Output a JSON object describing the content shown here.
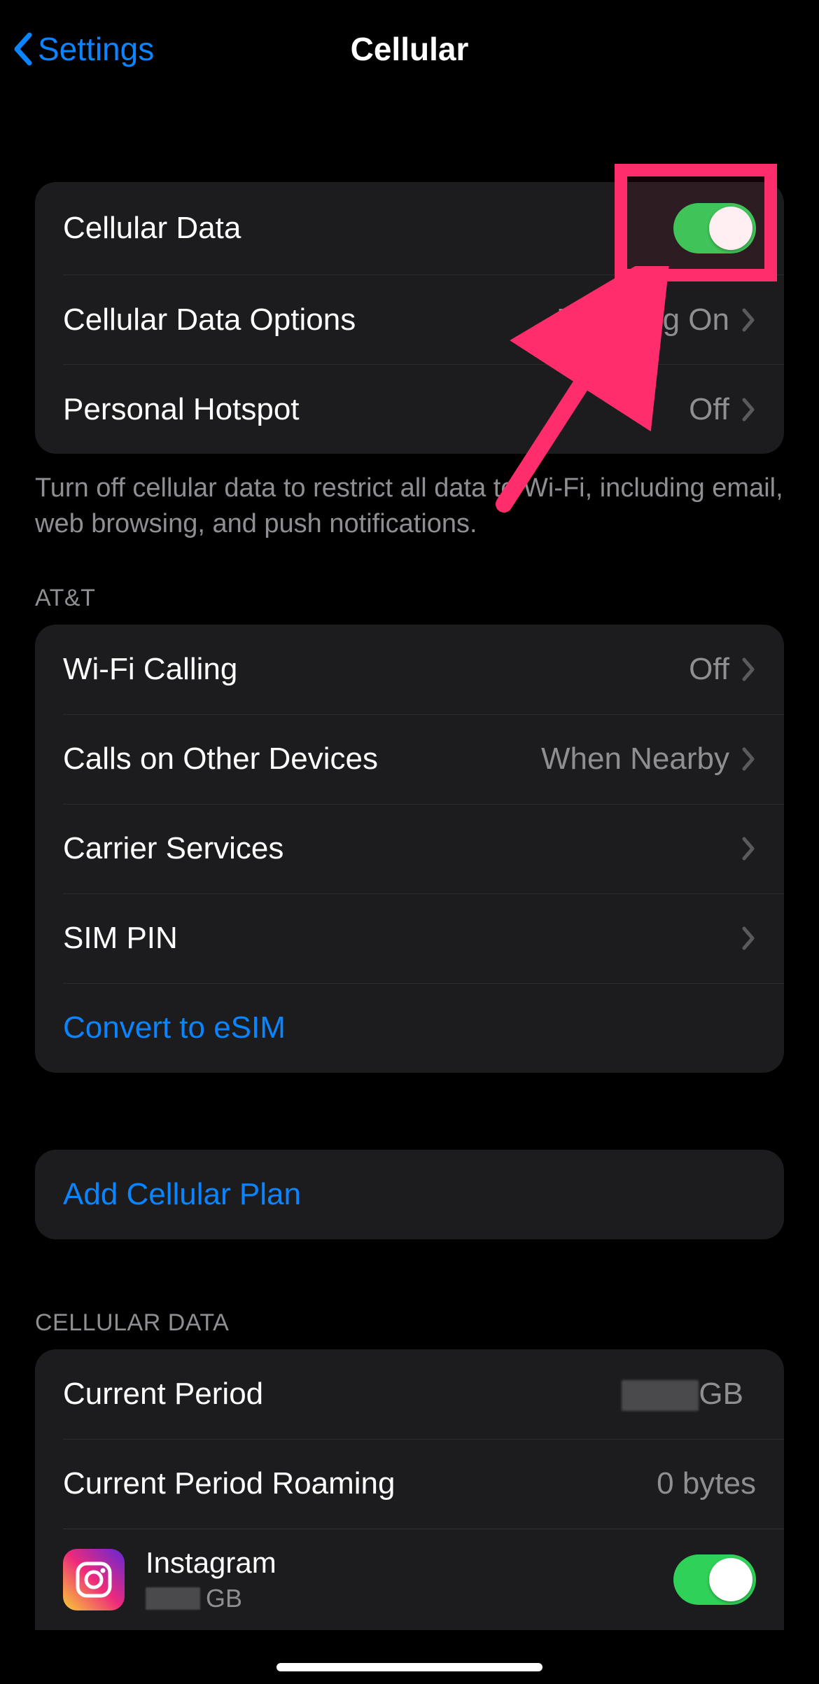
{
  "nav": {
    "back_label": "Settings",
    "title": "Cellular"
  },
  "group_main": {
    "cellular_data": {
      "label": "Cellular Data",
      "on": true
    },
    "cellular_data_options": {
      "label": "Cellular Data Options",
      "value": "Roaming On"
    },
    "personal_hotspot": {
      "label": "Personal Hotspot",
      "value": "Off"
    },
    "footer": "Turn off cellular data to restrict all data to Wi-Fi, including email, web browsing, and push notifications."
  },
  "carrier_header": "AT&T",
  "group_carrier": {
    "wifi_calling": {
      "label": "Wi-Fi Calling",
      "value": "Off"
    },
    "calls_other": {
      "label": "Calls on Other Devices",
      "value": "When Nearby"
    },
    "carrier_services": {
      "label": "Carrier Services"
    },
    "sim_pin": {
      "label": "SIM PIN"
    },
    "convert_esim": {
      "label": "Convert to eSIM"
    }
  },
  "add_plan": {
    "label": "Add Cellular Plan"
  },
  "usage_header": "CELLULAR DATA",
  "group_usage": {
    "current_period": {
      "label": "Current Period",
      "value_suffix": "GB"
    },
    "current_period_roaming": {
      "label": "Current Period Roaming",
      "value": "0 bytes"
    },
    "instagram": {
      "name": "Instagram",
      "sub_suffix": "GB",
      "on": true
    }
  },
  "annotation": {
    "highlight_target": "cellular-data-toggle",
    "color": "#ff2d6b"
  }
}
